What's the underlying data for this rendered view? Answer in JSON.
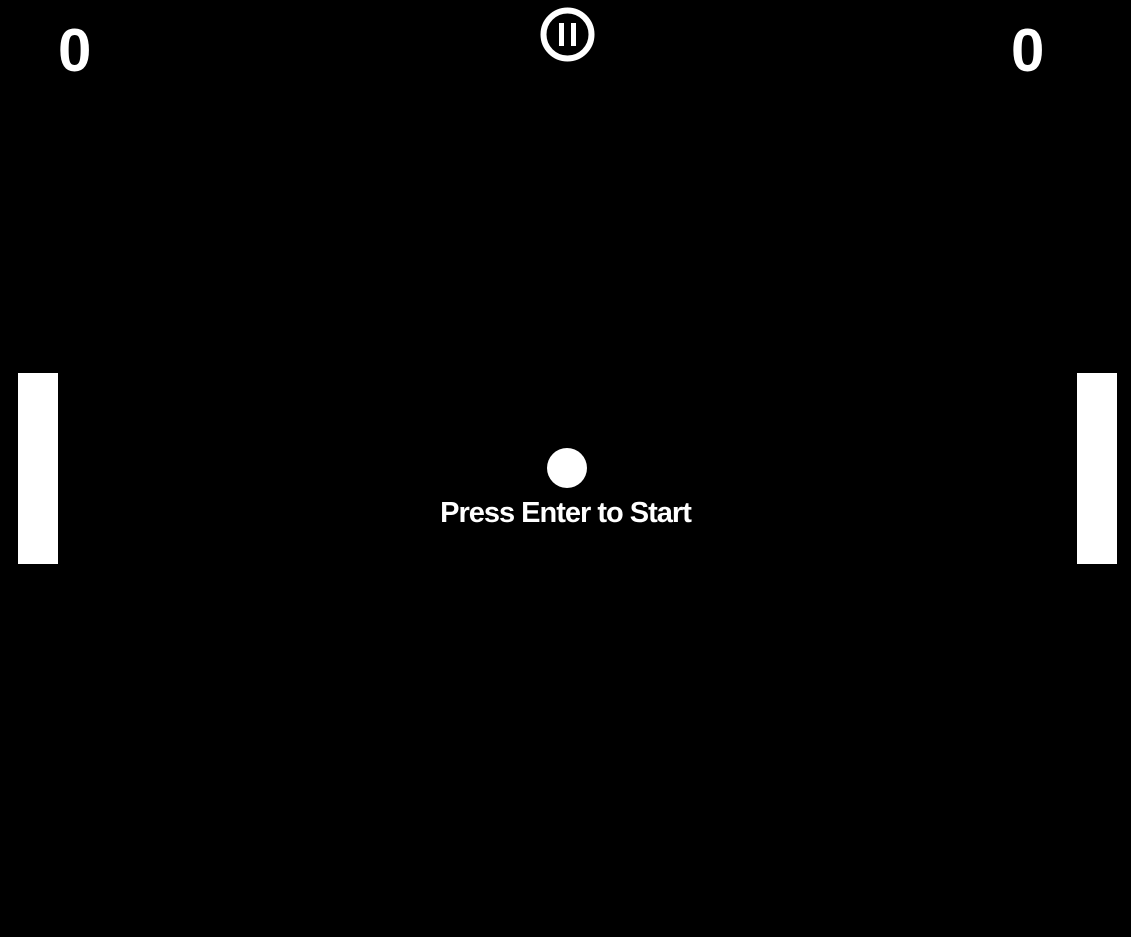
{
  "scoreboard": {
    "left_score": "0",
    "right_score": "0"
  },
  "controls": {
    "pause_icon": "pause-icon"
  },
  "message": {
    "prompt": "Press Enter to Start"
  },
  "colors": {
    "background": "#000000",
    "foreground": "#ffffff"
  }
}
